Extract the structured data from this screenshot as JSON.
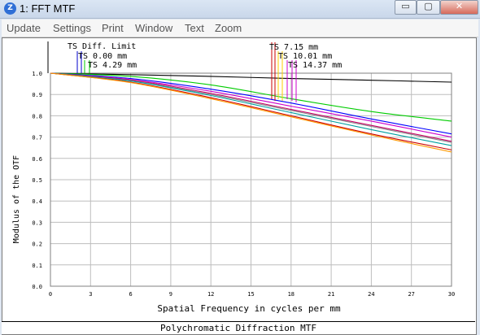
{
  "window": {
    "icon_text": "Z",
    "title": "1: FFT MTF",
    "min_symbol": "▭",
    "max_symbol": "▢",
    "close_symbol": "✕"
  },
  "menu": [
    "Update",
    "Settings",
    "Print",
    "Window",
    "Text",
    "Zoom"
  ],
  "footer": {
    "caption": "Polychromatic Diffraction MTF"
  },
  "chart_data": {
    "type": "line",
    "title": "",
    "xlabel": "Spatial Frequency in cycles per mm",
    "ylabel": "Modulus of the OTF",
    "xlim": [
      0,
      30
    ],
    "ylim": [
      0,
      1.0
    ],
    "x_ticks": [
      "0",
      "3",
      "6",
      "9",
      "12",
      "15",
      "18",
      "21",
      "24",
      "27",
      "30"
    ],
    "y_ticks": [
      "0.0",
      "0.1",
      "0.2",
      "0.3",
      "0.4",
      "0.5",
      "0.6",
      "0.7",
      "0.8",
      "0.9",
      "1.0"
    ],
    "grid": true,
    "legend": [
      {
        "label": "TS Diff. Limit",
        "color": "#000000"
      },
      {
        "label": "TS 0.00 mm",
        "color": "#0000cc"
      },
      {
        "label": "TS 4.29 mm",
        "color": "#00cc00"
      },
      {
        "label": "TS 7.15 mm",
        "color": "#cc0000"
      },
      {
        "label": "TS 10.01 mm",
        "color": "#ffcc00"
      },
      {
        "label": "TS 14.37 mm",
        "color": "#cc00cc"
      }
    ],
    "x": [
      0,
      6,
      12,
      18,
      24,
      30
    ],
    "series": [
      {
        "color": "#000000",
        "values": [
          1.0,
          0.993,
          0.985,
          0.975,
          0.967,
          0.958
        ]
      },
      {
        "color": "#00cc00",
        "values": [
          1.0,
          0.985,
          0.945,
          0.88,
          0.82,
          0.775
        ]
      },
      {
        "color": "#0000ff",
        "values": [
          1.0,
          0.975,
          0.925,
          0.86,
          0.785,
          0.715
        ]
      },
      {
        "color": "#cc00cc",
        "values": [
          1.0,
          0.97,
          0.915,
          0.845,
          0.775,
          0.7
        ]
      },
      {
        "color": "#c80064",
        "values": [
          1.0,
          0.968,
          0.905,
          0.83,
          0.755,
          0.68
        ]
      },
      {
        "color": "#8a8a8a",
        "values": [
          1.0,
          0.965,
          0.9,
          0.825,
          0.75,
          0.675
        ]
      },
      {
        "color": "#00a0a0",
        "values": [
          1.0,
          0.963,
          0.895,
          0.815,
          0.735,
          0.66
        ]
      },
      {
        "color": "#cc0000",
        "values": [
          1.0,
          0.958,
          0.885,
          0.8,
          0.715,
          0.64
        ]
      },
      {
        "color": "#ff9900",
        "values": [
          1.0,
          0.956,
          0.88,
          0.795,
          0.71,
          0.63
        ]
      }
    ]
  }
}
